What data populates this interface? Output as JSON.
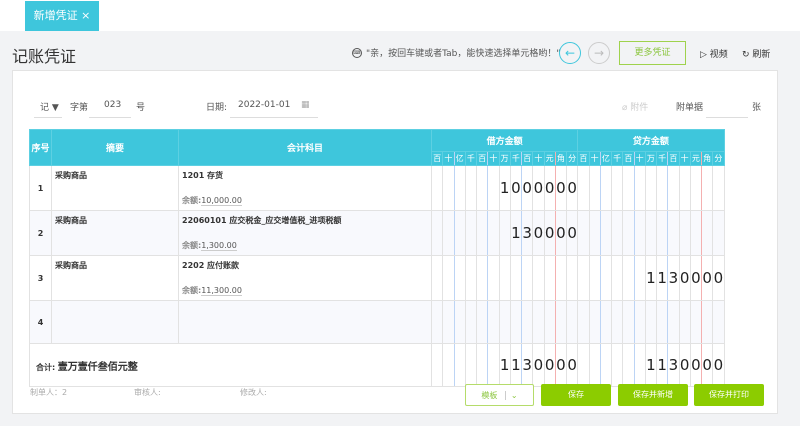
{
  "tab": {
    "label": "新增凭证",
    "close": "×"
  },
  "title": "记账凭证",
  "hint": "\"亲，按回车键或者Tab，能快速选择单元格哟！\"",
  "nav": {
    "prev": "←",
    "next": "→"
  },
  "more_button": "更多凭证",
  "video": "视频",
  "refresh": "刷新",
  "voucher": {
    "type": "记",
    "zi": "字第",
    "number": "023",
    "hao": "号",
    "date_label": "日期:",
    "date": "2022-01-01",
    "attach": "附件",
    "attach_label": "附单据",
    "attach_unit": "张"
  },
  "table": {
    "headers": {
      "seq": "序号",
      "summary": "摘要",
      "account": "会计科目",
      "debit": "借方金额",
      "credit": "贷方金额"
    },
    "units": [
      "百",
      "十",
      "亿",
      "千",
      "百",
      "十",
      "万",
      "千",
      "百",
      "十",
      "元",
      "角",
      "分"
    ],
    "rows": [
      {
        "seq": "1",
        "summary": "采购商品",
        "account": "1201 存货",
        "balance_label": "余额:",
        "balance": "10,000.00",
        "debit": "1000000",
        "credit": ""
      },
      {
        "seq": "2",
        "summary": "采购商品",
        "account": "22060101 应交税金_应交增值税_进项税额",
        "balance_label": "余额:",
        "balance": "1,300.00",
        "debit": "130000",
        "credit": ""
      },
      {
        "seq": "3",
        "summary": "采购商品",
        "account": "2202 应付账款",
        "balance_label": "余额:",
        "balance": "11,300.00",
        "debit": "",
        "credit": "1130000"
      },
      {
        "seq": "4",
        "summary": "",
        "account": "",
        "balance_label": "",
        "balance": "",
        "debit": "",
        "credit": ""
      }
    ],
    "total": {
      "label": "合计:",
      "words": "壹万壹仟叁佰元整",
      "debit": "1130000",
      "credit": "1130000"
    }
  },
  "footer": {
    "maker": "制单人：2",
    "reviewer": "审核人:",
    "modifier": "修改人:"
  },
  "buttons": {
    "template": "模板",
    "save": "保存",
    "save_new": "保存并新增",
    "save_print": "保存并打印"
  }
}
